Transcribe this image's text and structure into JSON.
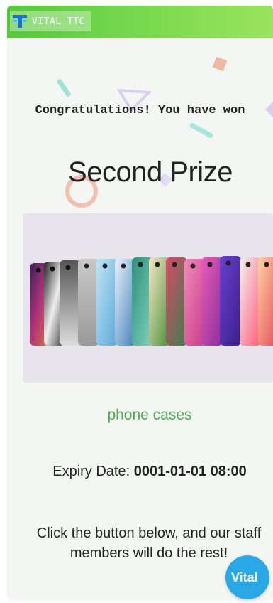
{
  "brand": {
    "name": "VITAL TTC",
    "logo_icon": "vital-logo-icon"
  },
  "congrats": {
    "heading": "Congratulations! You have won"
  },
  "prize": {
    "title": "Second Prize",
    "name": "phone cases",
    "image_icon": "phone-cases-photo"
  },
  "expiry": {
    "label": "Expiry Date:",
    "value": "0001-01-01 08:00"
  },
  "instructions": "Click the button below, and our staff members will do the rest!",
  "fab": {
    "label": "Vital",
    "icon": "vital-logo-icon"
  },
  "colors": {
    "header_start": "#55c93a",
    "header_end": "#9be35c",
    "prize_name": "#4caf50",
    "fab": "#2aa8e6"
  }
}
